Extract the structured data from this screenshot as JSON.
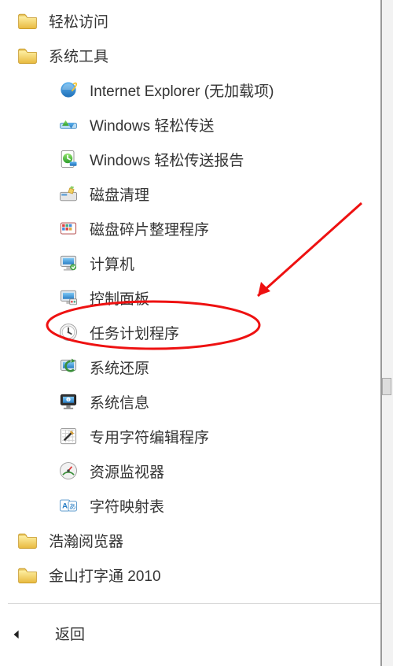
{
  "menu": {
    "items": [
      {
        "label": "轻松访问",
        "level": 1,
        "icon": "folder"
      },
      {
        "label": "系统工具",
        "level": 1,
        "icon": "folder"
      },
      {
        "label": "Internet Explorer (无加载项)",
        "level": 2,
        "icon": "ie"
      },
      {
        "label": "Windows 轻松传送",
        "level": 2,
        "icon": "transfer"
      },
      {
        "label": "Windows 轻松传送报告",
        "level": 2,
        "icon": "transfer-report"
      },
      {
        "label": "磁盘清理",
        "level": 2,
        "icon": "disk-clean"
      },
      {
        "label": "磁盘碎片整理程序",
        "level": 2,
        "icon": "defrag"
      },
      {
        "label": "计算机",
        "level": 2,
        "icon": "computer"
      },
      {
        "label": "控制面板",
        "level": 2,
        "icon": "control-panel"
      },
      {
        "label": "任务计划程序",
        "level": 2,
        "icon": "task-scheduler",
        "circled": true
      },
      {
        "label": "系统还原",
        "level": 2,
        "icon": "restore"
      },
      {
        "label": "系统信息",
        "level": 2,
        "icon": "sysinfo"
      },
      {
        "label": "专用字符编辑程序",
        "level": 2,
        "icon": "eudcedit"
      },
      {
        "label": "资源监视器",
        "level": 2,
        "icon": "resmon"
      },
      {
        "label": "字符映射表",
        "level": 2,
        "icon": "charmap"
      },
      {
        "label": "浩瀚阅览器",
        "level": 1,
        "icon": "folder"
      },
      {
        "label": "金山打字通 2010",
        "level": 1,
        "icon": "folder"
      }
    ]
  },
  "back_label": "返回"
}
